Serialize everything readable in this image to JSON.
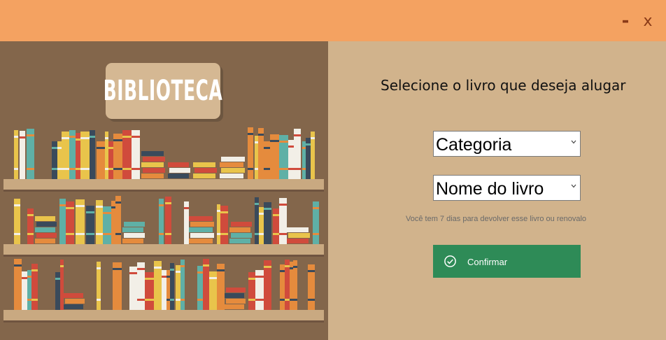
{
  "window": {
    "minimize_glyph": "-",
    "close_glyph": "x"
  },
  "banner": {
    "title": "BIBLIOTECA"
  },
  "form": {
    "heading": "Selecione o livro que deseja alugar",
    "category": {
      "value": "Categoria"
    },
    "book": {
      "value": "Nome do livro"
    },
    "note": "Você tem 7 dias para devolver esse livro ou renovalo",
    "confirm_label": "Confirmar"
  },
  "colors": {
    "titlebar": "#f4a261",
    "left_panel": "#83664b",
    "right_panel": "#d1b38c",
    "shelf": "#c9a981",
    "confirm": "#2e8b57",
    "book_palette": [
      "#d04b3c",
      "#3a4a5b",
      "#e9c44b",
      "#5fb0a6",
      "#f2efe7",
      "#e58b3d"
    ]
  },
  "icons": {
    "dropdown": "chevron-down-icon",
    "confirm": "check-circle-icon"
  }
}
